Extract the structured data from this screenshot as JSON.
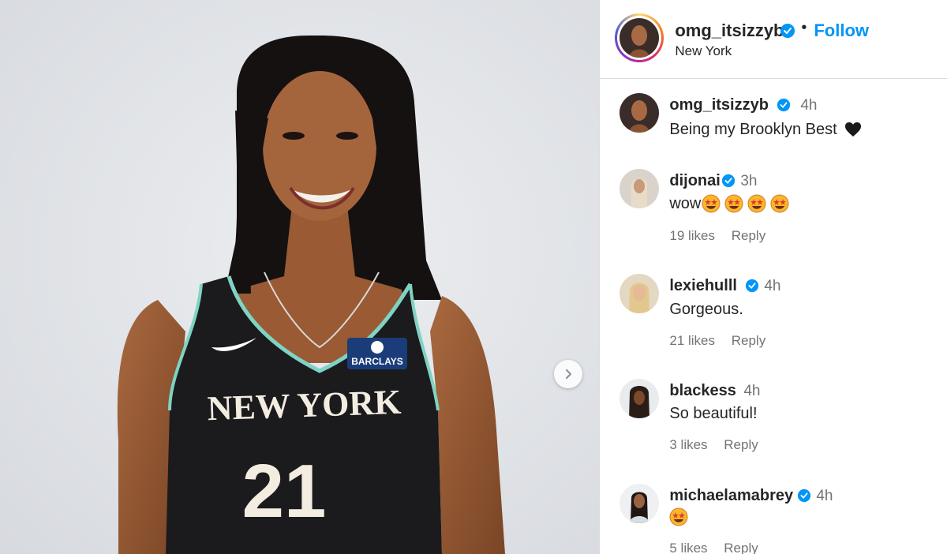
{
  "post": {
    "author": "omg_itsizzyb",
    "follow_label": "Follow",
    "separator": "•",
    "location": "New York",
    "caption": "Being my Brooklyn Best",
    "caption_emoji": "🖤",
    "caption_time": "4h"
  },
  "media": {
    "jersey_city": "NEW YORK",
    "jersey_number": "21",
    "sponsor": "BARCLAYS",
    "next_icon": "chevron-right-icon"
  },
  "comments": [
    {
      "user": "dijonai",
      "verified": true,
      "time": "3h",
      "text": "wow",
      "emoji_count": 4,
      "likes": "19 likes",
      "reply": "Reply"
    },
    {
      "user": "lexiehulll",
      "verified": true,
      "time": "4h",
      "text": "Gorgeous.",
      "emoji_count": 0,
      "likes": "21 likes",
      "reply": "Reply"
    },
    {
      "user": "blackess",
      "verified": false,
      "time": "4h",
      "text": "So beautiful!",
      "emoji_count": 0,
      "likes": "3 likes",
      "reply": "Reply"
    },
    {
      "user": "michaelamabrey",
      "verified": true,
      "time": "4h",
      "text": "",
      "emoji_count": 1,
      "likes": "5 likes",
      "reply": "Reply"
    }
  ],
  "colors": {
    "link": "#0095f6",
    "verified": "#0095f6",
    "muted": "#737373",
    "text": "#262626"
  },
  "icons": {
    "verified": "verified-badge-icon",
    "emoji": "star-struck-emoji-icon",
    "heart": "black-heart-icon"
  }
}
